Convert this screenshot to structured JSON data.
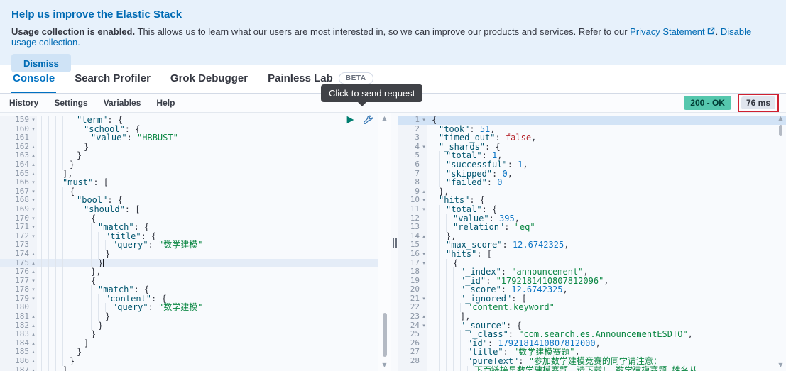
{
  "banner": {
    "title": "Help us improve the Elastic Stack",
    "bold": "Usage collection is enabled.",
    "text1": " This allows us to learn what our users are most interested in, so we can improve our products and services. Refer to our ",
    "privacy_link": "Privacy Statement",
    "sep": ". ",
    "disable_link": "Disable usage collection.",
    "dismiss": "Dismiss"
  },
  "tabs": [
    {
      "label": "Console",
      "active": true
    },
    {
      "label": "Search Profiler",
      "active": false
    },
    {
      "label": "Grok Debugger",
      "active": false
    },
    {
      "label": "Painless Lab",
      "active": false,
      "badge": "BETA"
    }
  ],
  "menu": [
    "History",
    "Settings",
    "Variables",
    "Help"
  ],
  "tooltip": "Click to send request",
  "status": {
    "code": "200 - OK",
    "time": "76 ms"
  },
  "icons": {
    "send": "play-icon",
    "options": "wrench-icon",
    "scroll_up": "▲",
    "scroll_down": "▼",
    "fold_open": "▾",
    "fold_close": "▴"
  },
  "colors": {
    "accent_blue": "#006bb4",
    "banner_bg": "#e7f1fb",
    "success_badge_bg": "#55c7ad",
    "time_badge_bg": "#e0e5ee",
    "annotation_red": "#cf2030",
    "tooltip_bg": "#404247",
    "token_key": "#00556e",
    "token_string": "#0a8642",
    "token_number": "#0b74c4",
    "token_boolean": "#b5232a",
    "active_line": "#e4ecf7",
    "selected_line": "#d2e3f6"
  },
  "editor": {
    "lines": [
      {
        "n": 159,
        "f": "o",
        "i": 5,
        "t": [
          [
            "k",
            "\"term\""
          ],
          [
            "p",
            ": {"
          ]
        ]
      },
      {
        "n": 160,
        "f": "o",
        "i": 6,
        "t": [
          [
            "k",
            "\"school\""
          ],
          [
            "p",
            ": {"
          ]
        ]
      },
      {
        "n": 161,
        "f": "",
        "i": 7,
        "t": [
          [
            "k",
            "\"value\""
          ],
          [
            "p",
            ": "
          ],
          [
            "s",
            "\"HRBUST\""
          ]
        ]
      },
      {
        "n": 162,
        "f": "c",
        "i": 6,
        "t": [
          [
            "p",
            "}"
          ]
        ]
      },
      {
        "n": 163,
        "f": "c",
        "i": 5,
        "t": [
          [
            "p",
            "}"
          ]
        ]
      },
      {
        "n": 164,
        "f": "c",
        "i": 4,
        "t": [
          [
            "p",
            "}"
          ]
        ]
      },
      {
        "n": 165,
        "f": "c",
        "i": 3,
        "t": [
          [
            "p",
            "],"
          ]
        ]
      },
      {
        "n": 166,
        "f": "o",
        "i": 3,
        "t": [
          [
            "k",
            "\"must\""
          ],
          [
            "p",
            ": ["
          ]
        ]
      },
      {
        "n": 167,
        "f": "o",
        "i": 4,
        "t": [
          [
            "p",
            "{"
          ]
        ]
      },
      {
        "n": 168,
        "f": "o",
        "i": 5,
        "t": [
          [
            "k",
            "\"bool\""
          ],
          [
            "p",
            ": {"
          ]
        ]
      },
      {
        "n": 169,
        "f": "o",
        "i": 6,
        "t": [
          [
            "k",
            "\"should\""
          ],
          [
            "p",
            ": ["
          ]
        ]
      },
      {
        "n": 170,
        "f": "o",
        "i": 7,
        "t": [
          [
            "p",
            "{"
          ]
        ]
      },
      {
        "n": 171,
        "f": "o",
        "i": 8,
        "t": [
          [
            "k",
            "\"match\""
          ],
          [
            "p",
            ": {"
          ]
        ]
      },
      {
        "n": 172,
        "f": "o",
        "i": 9,
        "t": [
          [
            "k",
            "\"title\""
          ],
          [
            "p",
            ": {"
          ]
        ]
      },
      {
        "n": 173,
        "f": "",
        "i": 10,
        "t": [
          [
            "k",
            "\"query\""
          ],
          [
            "p",
            ": "
          ],
          [
            "s",
            "\"数学建模\""
          ]
        ]
      },
      {
        "n": 174,
        "f": "c",
        "i": 9,
        "t": [
          [
            "p",
            "}"
          ]
        ]
      },
      {
        "n": 175,
        "f": "c",
        "i": 8,
        "t": [
          [
            "p",
            "}"
          ]
        ],
        "active": true,
        "caret": true
      },
      {
        "n": 176,
        "f": "c",
        "i": 7,
        "t": [
          [
            "p",
            "},"
          ]
        ]
      },
      {
        "n": 177,
        "f": "o",
        "i": 7,
        "t": [
          [
            "p",
            "{"
          ]
        ]
      },
      {
        "n": 178,
        "f": "o",
        "i": 8,
        "t": [
          [
            "k",
            "\"match\""
          ],
          [
            "p",
            ": {"
          ]
        ]
      },
      {
        "n": 179,
        "f": "o",
        "i": 9,
        "t": [
          [
            "k",
            "\"content\""
          ],
          [
            "p",
            ": {"
          ]
        ]
      },
      {
        "n": 180,
        "f": "",
        "i": 10,
        "t": [
          [
            "k",
            "\"query\""
          ],
          [
            "p",
            ": "
          ],
          [
            "s",
            "\"数学建模\""
          ]
        ]
      },
      {
        "n": 181,
        "f": "c",
        "i": 9,
        "t": [
          [
            "p",
            "}"
          ]
        ]
      },
      {
        "n": 182,
        "f": "c",
        "i": 8,
        "t": [
          [
            "p",
            "}"
          ]
        ]
      },
      {
        "n": 183,
        "f": "c",
        "i": 7,
        "t": [
          [
            "p",
            "}"
          ]
        ]
      },
      {
        "n": 184,
        "f": "c",
        "i": 6,
        "t": [
          [
            "p",
            "]"
          ]
        ]
      },
      {
        "n": 185,
        "f": "c",
        "i": 5,
        "t": [
          [
            "p",
            "}"
          ]
        ]
      },
      {
        "n": 186,
        "f": "c",
        "i": 4,
        "t": [
          [
            "p",
            "}"
          ]
        ]
      },
      {
        "n": 187,
        "f": "c",
        "i": 3,
        "t": [
          [
            "p",
            "]"
          ]
        ]
      }
    ]
  },
  "response": {
    "lines": [
      {
        "n": 1,
        "f": "o",
        "i": 0,
        "t": [
          [
            "p",
            "{"
          ]
        ],
        "selected": true
      },
      {
        "n": 2,
        "f": "",
        "i": 1,
        "t": [
          [
            "k",
            "\"took\""
          ],
          [
            "p",
            ": "
          ],
          [
            "n",
            "51"
          ],
          [
            "p",
            ","
          ]
        ]
      },
      {
        "n": 3,
        "f": "",
        "i": 1,
        "t": [
          [
            "k",
            "\"timed_out\""
          ],
          [
            "p",
            ": "
          ],
          [
            "b",
            "false"
          ],
          [
            "p",
            ","
          ]
        ]
      },
      {
        "n": 4,
        "f": "o",
        "i": 1,
        "t": [
          [
            "k",
            "\"_shards\""
          ],
          [
            "p",
            ": {"
          ]
        ]
      },
      {
        "n": 5,
        "f": "",
        "i": 2,
        "t": [
          [
            "k",
            "\"total\""
          ],
          [
            "p",
            ": "
          ],
          [
            "n",
            "1"
          ],
          [
            "p",
            ","
          ]
        ]
      },
      {
        "n": 6,
        "f": "",
        "i": 2,
        "t": [
          [
            "k",
            "\"successful\""
          ],
          [
            "p",
            ": "
          ],
          [
            "n",
            "1"
          ],
          [
            "p",
            ","
          ]
        ]
      },
      {
        "n": 7,
        "f": "",
        "i": 2,
        "t": [
          [
            "k",
            "\"skipped\""
          ],
          [
            "p",
            ": "
          ],
          [
            "n",
            "0"
          ],
          [
            "p",
            ","
          ]
        ]
      },
      {
        "n": 8,
        "f": "",
        "i": 2,
        "t": [
          [
            "k",
            "\"failed\""
          ],
          [
            "p",
            ": "
          ],
          [
            "n",
            "0"
          ]
        ]
      },
      {
        "n": 9,
        "f": "c",
        "i": 1,
        "t": [
          [
            "p",
            "},"
          ]
        ]
      },
      {
        "n": 10,
        "f": "o",
        "i": 1,
        "t": [
          [
            "k",
            "\"hits\""
          ],
          [
            "p",
            ": {"
          ]
        ]
      },
      {
        "n": 11,
        "f": "o",
        "i": 2,
        "t": [
          [
            "k",
            "\"total\""
          ],
          [
            "p",
            ": {"
          ]
        ]
      },
      {
        "n": 12,
        "f": "",
        "i": 3,
        "t": [
          [
            "k",
            "\"value\""
          ],
          [
            "p",
            ": "
          ],
          [
            "n",
            "395"
          ],
          [
            "p",
            ","
          ]
        ]
      },
      {
        "n": 13,
        "f": "",
        "i": 3,
        "t": [
          [
            "k",
            "\"relation\""
          ],
          [
            "p",
            ": "
          ],
          [
            "s",
            "\"eq\""
          ]
        ]
      },
      {
        "n": 14,
        "f": "c",
        "i": 2,
        "t": [
          [
            "p",
            "},"
          ]
        ]
      },
      {
        "n": 15,
        "f": "",
        "i": 2,
        "t": [
          [
            "k",
            "\"max_score\""
          ],
          [
            "p",
            ": "
          ],
          [
            "n",
            "12.6742325"
          ],
          [
            "p",
            ","
          ]
        ]
      },
      {
        "n": 16,
        "f": "o",
        "i": 2,
        "t": [
          [
            "k",
            "\"hits\""
          ],
          [
            "p",
            ": ["
          ]
        ]
      },
      {
        "n": 17,
        "f": "o",
        "i": 3,
        "t": [
          [
            "p",
            "{"
          ]
        ]
      },
      {
        "n": 18,
        "f": "",
        "i": 4,
        "t": [
          [
            "k",
            "\"_index\""
          ],
          [
            "p",
            ": "
          ],
          [
            "s",
            "\"announcement\""
          ],
          [
            "p",
            ","
          ]
        ]
      },
      {
        "n": 19,
        "f": "",
        "i": 4,
        "t": [
          [
            "k",
            "\"_id\""
          ],
          [
            "p",
            ": "
          ],
          [
            "s",
            "\"1792181410807812096\""
          ],
          [
            "p",
            ","
          ]
        ]
      },
      {
        "n": 20,
        "f": "",
        "i": 4,
        "t": [
          [
            "k",
            "\"_score\""
          ],
          [
            "p",
            ": "
          ],
          [
            "n",
            "12.6742325"
          ],
          [
            "p",
            ","
          ]
        ]
      },
      {
        "n": 21,
        "f": "o",
        "i": 4,
        "t": [
          [
            "k",
            "\"_ignored\""
          ],
          [
            "p",
            ": ["
          ]
        ]
      },
      {
        "n": 22,
        "f": "",
        "i": 5,
        "t": [
          [
            "s",
            "\"content.keyword\""
          ]
        ]
      },
      {
        "n": 23,
        "f": "c",
        "i": 4,
        "t": [
          [
            "p",
            "],"
          ]
        ]
      },
      {
        "n": 24,
        "f": "o",
        "i": 4,
        "t": [
          [
            "k",
            "\"_source\""
          ],
          [
            "p",
            ": {"
          ]
        ]
      },
      {
        "n": 25,
        "f": "",
        "i": 5,
        "t": [
          [
            "k",
            "\"_class\""
          ],
          [
            "p",
            ": "
          ],
          [
            "s",
            "\"com.search.es.AnnouncementESDTO\""
          ],
          [
            "p",
            ","
          ]
        ]
      },
      {
        "n": 26,
        "f": "",
        "i": 5,
        "t": [
          [
            "k",
            "\"id\""
          ],
          [
            "p",
            ": "
          ],
          [
            "n",
            "1792181410807812000"
          ],
          [
            "p",
            ","
          ]
        ]
      },
      {
        "n": 27,
        "f": "",
        "i": 5,
        "t": [
          [
            "k",
            "\"title\""
          ],
          [
            "p",
            ": "
          ],
          [
            "s",
            "\"数学建模赛题\""
          ],
          [
            "p",
            ","
          ]
        ]
      },
      {
        "n": 28,
        "f": "",
        "i": 5,
        "t": [
          [
            "k",
            "\"pureText\""
          ],
          [
            "p",
            ": "
          ],
          [
            "s",
            "\"参加数学建模竞赛的同学请注意："
          ]
        ]
      },
      {
        "n": "",
        "f": "",
        "i": 6,
        "t": [
          [
            "s",
            "下面链接是数学建模赛题，请下载！ 数学建模赛题 姓名从"
          ]
        ]
      }
    ]
  }
}
